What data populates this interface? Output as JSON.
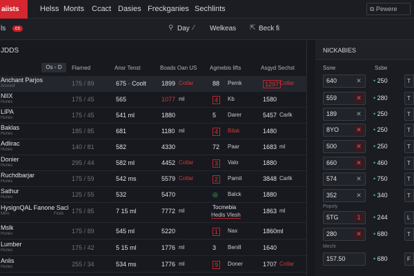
{
  "topbar": {
    "brand": "aiists",
    "nav": [
      "Helss",
      "Monts",
      "Ccact",
      "Dasies",
      "Freckganies",
      "Sechlints"
    ],
    "preview": "Pewere"
  },
  "subbar": {
    "label": "ls",
    "badge": "cs",
    "items": [
      "Day",
      "Welkeas",
      "Beck fi"
    ]
  },
  "main": {
    "title": "JDDS",
    "filter_chip": "Os ◦ D",
    "columns": [
      "Flarned",
      "Ansr Tenst",
      "Boads Oan US",
      "Agmebis lifts",
      "Asgyd Sechst"
    ],
    "rows": [
      {
        "name": "Anchant Parjos",
        "sub": "Ansreof",
        "sub2": "",
        "c1": "175 / 89",
        "c2": "675 · Coolt",
        "c3": "1899",
        "c3b": "Cotlar",
        "c4": "88",
        "c4b": "Pemk",
        "c5": "1297",
        "c5b": "Cotlar",
        "selected": true,
        "c3b_red": true,
        "c4_box": false,
        "c5_red": true
      },
      {
        "name": "NIIX",
        "sub": "Hunes",
        "sub2": "",
        "c1": "175 / 45",
        "c2": "565",
        "c3": "1077",
        "c3b": "ml",
        "c4": "4",
        "c4b": "Kb",
        "c5": "1580",
        "c5b": "",
        "selected": false,
        "c3_red": true,
        "c4_box": true
      },
      {
        "name": "LIPA",
        "sub": "Hunes",
        "sub2": "",
        "c1": "175 / 45",
        "c2": "541 ml",
        "c3": "1880",
        "c3b": "",
        "c4": "5",
        "c4b": "Darer",
        "c5": "5457",
        "c5b": "Carlk",
        "selected": false
      },
      {
        "name": "Baklas",
        "sub": "Hunes",
        "sub2": "",
        "c1": "185 / 85",
        "c2": "681",
        "c3": "1180",
        "c3b": "ml",
        "c4": "4",
        "c4b": "Bilak",
        "c5": "1480",
        "c5b": "",
        "selected": false,
        "c4_box": true,
        "c4b_red": true
      },
      {
        "name": "Adlirac",
        "sub": "Hunes",
        "sub2": "",
        "c1": "140 / 81",
        "c2": "582",
        "c3": "4330",
        "c3b": "",
        "c4": "72",
        "c4b": "Paar",
        "c5": "1683",
        "c5b": "ml",
        "selected": false
      },
      {
        "name": "Donier",
        "sub": "Hunes",
        "sub2": "",
        "c1": "295 / 44",
        "c2": "582 ml",
        "c3": "4452",
        "c3b": "Cotlar",
        "c4": "3",
        "c4b": "Valo",
        "c5": "1880",
        "c5b": "",
        "selected": false,
        "c3b_red": true,
        "c4_box": true
      },
      {
        "name": "Ruchdbarjar",
        "sub": "Hunes",
        "sub2": "",
        "c1": "175 / 59",
        "c2": "542 ms",
        "c3": "5579",
        "c3b": "Cotlar",
        "c4": "2",
        "c4b": "Pamit",
        "c5": "3848",
        "c5b": "Carlk",
        "selected": false,
        "c3b_red": true,
        "c4_box": true
      },
      {
        "name": "Sathur",
        "sub": "Hunes",
        "sub2": "",
        "c1": "125 / 55",
        "c2": "532",
        "c3": "5470",
        "c3b": "",
        "c4": "◎",
        "c4b": "Balck",
        "c5": "1880",
        "c5b": "",
        "selected": false,
        "c4_green": true
      },
      {
        "name": "HysignQAL Fanone Sacl",
        "sub": "Mins",
        "sub2": "Ficds",
        "c1": "175 / 85",
        "c2": "7 15 ml",
        "c3": "7772",
        "c3b": "ml",
        "c4": "Tocmebia",
        "c4b": "Hedis Vlesh",
        "c5": "1863",
        "c5b": "ml",
        "selected": false,
        "tall": true
      },
      {
        "name": "Mslk",
        "sub": "Hunes",
        "sub2": "",
        "c1": "175 / 89",
        "c2": "545 ml",
        "c3": "5220",
        "c3b": "",
        "c4": "1",
        "c4b": "Nax",
        "c5": "1860ml",
        "c5b": "",
        "selected": false,
        "c4_box": true
      },
      {
        "name": "Lumber",
        "sub": "Hunes",
        "sub2": "",
        "c1": "175 / 42",
        "c2": "5 15 ml",
        "c3": "1776",
        "c3b": "ml",
        "c4": "3",
        "c4b": "Benill",
        "c5": "1640",
        "c5b": "",
        "selected": false
      },
      {
        "name": "Anlis",
        "sub": "Hunes",
        "sub2": "",
        "c1": "255 / 34",
        "c2": "534 ms",
        "c3": "1776",
        "c3b": "ml",
        "c4": "9",
        "c4b": "Doner",
        "c5": "1707",
        "c5b": "Cotlar",
        "selected": false,
        "c4_box": true,
        "c5b_red": true
      }
    ]
  },
  "side": {
    "title": "NICKABIES",
    "col1": "Ssne",
    "col2": "Ssbe",
    "label_mid": "Popoly",
    "label_low": "Mechi",
    "rows": [
      {
        "input": "640",
        "x": "✕",
        "alert": false,
        "val": "250",
        "extra": "T"
      },
      {
        "input": "559",
        "x": "✕",
        "alert": true,
        "val": "280",
        "extra": "T"
      },
      {
        "input": "189",
        "x": "✕",
        "alert": false,
        "val": "250",
        "extra": "T"
      },
      {
        "input": "8YO",
        "x": "✕",
        "alert": true,
        "val": "250",
        "extra": "T"
      },
      {
        "input": "500",
        "x": "✕",
        "alert": true,
        "val": "250",
        "extra": "T"
      },
      {
        "input": "660",
        "x": "✕",
        "alert": true,
        "val": "460",
        "extra": "T"
      },
      {
        "input": "574",
        "x": "✕",
        "alert": false,
        "val": "750",
        "extra": "T"
      },
      {
        "input": "352",
        "x": "✕",
        "alert": false,
        "val": "340",
        "extra": "T"
      },
      {
        "input": "5TG",
        "x": "1",
        "alert": true,
        "val": "244",
        "extra": "L"
      },
      {
        "input": "280",
        "x": "✕",
        "alert": true,
        "val": "680",
        "extra": "T"
      },
      {
        "input": "157.50",
        "x": "",
        "alert": false,
        "val": "680",
        "extra": "F"
      }
    ]
  },
  "colors": {
    "accent": "#d6262f",
    "background": "#16181d",
    "positive": "#3ec46d"
  }
}
